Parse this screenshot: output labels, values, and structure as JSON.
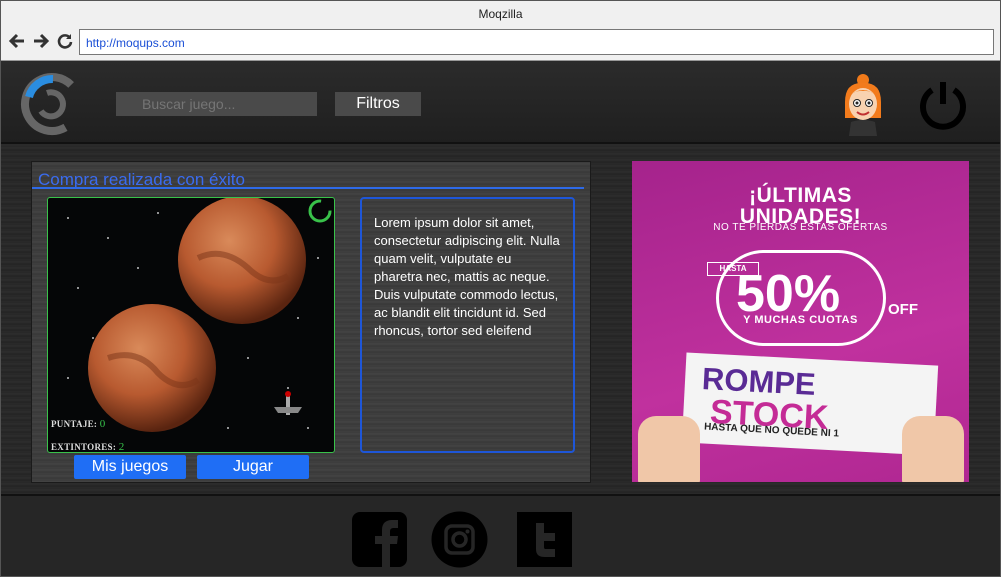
{
  "browser": {
    "window_title": "Moqzilla",
    "url": "http://moqups.com",
    "back_icon": "arrow-left-icon",
    "forward_icon": "arrow-right-icon",
    "reload_icon": "reload-icon"
  },
  "header": {
    "search_placeholder": "Buscar juego...",
    "filters_label": "Filtros",
    "logo_icon": "spinner-logo-icon",
    "avatar_icon": "user-avatar-icon",
    "power_icon": "power-icon"
  },
  "purchase": {
    "title": "Compra realizada con éxito",
    "score_label": "PUNTAJE:",
    "score_value": "0",
    "extinguishers_label": "EXTINTORES:",
    "extinguishers_value": "2",
    "description": "Lorem ipsum dolor sit amet, consectetur adipiscing elit. Nulla quam velit, vulputate eu pharetra nec, mattis ac neque. Duis vulputate commodo lectus, ac blandit elit tincidunt id. Sed rhoncus, tortor sed eleifend",
    "my_games_label": "Mis juegos",
    "play_label": "Jugar"
  },
  "ad": {
    "headline_line1": "¡ÚLTIMAS",
    "headline_line2": "UNIDADES!",
    "subheadline": "NO TE PIERDAS ESTAS OFERTAS",
    "hasta": "HASTA",
    "percent": "50%",
    "off": "OFF",
    "cuotas": "Y MUCHAS CUOTAS",
    "brand_line1": "ROMPE",
    "brand_line2": "STOCK",
    "tagline": "HASTA QUE NO QUEDE NI 1"
  },
  "footer": {
    "social_icons": [
      "facebook-icon",
      "instagram-icon",
      "twitter-icon"
    ]
  },
  "colors": {
    "accent_blue": "#2e6ae8",
    "button_blue": "#1f6ef5",
    "game_border_green": "#39c24a",
    "ad_magenta": "#b42993"
  }
}
